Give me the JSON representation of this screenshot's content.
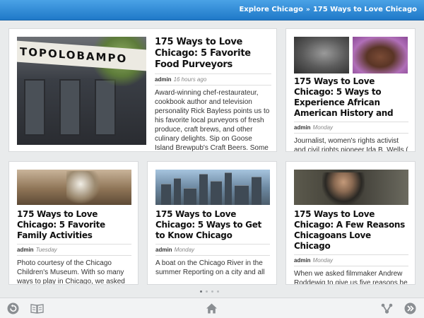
{
  "breadcrumb": {
    "root": "Explore Chicago",
    "separator": "»",
    "current": "175 Ways to Love Chicago"
  },
  "articles": {
    "feature": {
      "title": "175 Ways to Love Chicago: 5 Favorite Food Purveyors",
      "author": "admin",
      "time": "16 hours ago",
      "excerpt": "Award-winning chef-restaurateur, cookbook author and television personality Rick Bayless points us to his favorite local purveyors of fresh produce, craft brews, and other culinary delights. Sip on Goose Island Brewpub's Craft Beers. Some of the",
      "image_sign": "TOPOLOBAMPO"
    },
    "african_american": {
      "title": "175 Ways to Love Chicago: 5 Ways to Experience African American History and",
      "author": "admin",
      "time": "Monday",
      "excerpt": "Journalist, women's rights activist and civil rights pioneer Ida B. Wells ("
    },
    "family": {
      "title": "175 Ways to Love Chicago: 5 Favorite Family Activities",
      "author": "admin",
      "time": "Tuesday",
      "excerpt": "Photo courtesy of the Chicago Children's Museum. With so many ways to play in Chicago, we asked"
    },
    "get_to_know": {
      "title": "175 Ways to Love Chicago: 5 Ways to Get to Know Chicago",
      "author": "admin",
      "time": "Monday",
      "excerpt": "A boat on the Chicago River in the summer Reporting on a city and all"
    },
    "reasons": {
      "title": "175 Ways to Love Chicago: A Few Reasons Chicagoans Love Chicago",
      "author": "admin",
      "time": "Monday",
      "excerpt": "When we asked filmmaker Andrew Roddewig to give us five reasons he"
    }
  },
  "pagination": {
    "pages": 4,
    "current": 1
  },
  "bottom_bar": {
    "icons": [
      "back-icon",
      "book-icon",
      "home-icon",
      "share-icon",
      "forward-icon"
    ]
  },
  "colors": {
    "header_blue_top": "#4aa2e6",
    "header_blue_bottom": "#1f79c8",
    "icon_gray": "#8a8e92",
    "page_bg": "#e9ebec"
  }
}
